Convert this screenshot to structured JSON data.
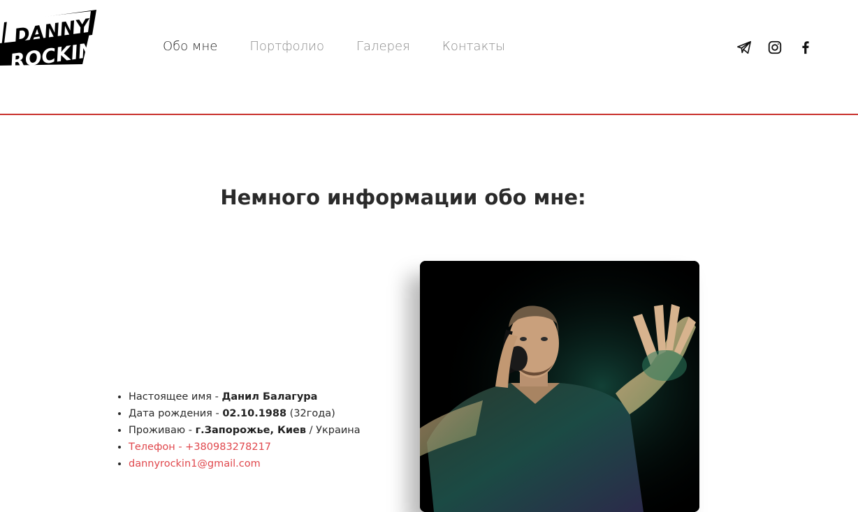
{
  "logo": {
    "line1": "DANNY",
    "line2": "ROCKIN"
  },
  "nav": [
    {
      "label": "Обо мне",
      "active": true
    },
    {
      "label": "Портфолио",
      "active": false
    },
    {
      "label": "Галерея",
      "active": false
    },
    {
      "label": "Контакты",
      "active": false
    }
  ],
  "social": [
    "telegram-icon",
    "instagram-icon",
    "facebook-icon"
  ],
  "section_title": "Немного информации обо мне:",
  "info": {
    "name_label": "Настоящее имя - ",
    "name_value": "Данил Балагура",
    "birth_label": "Дата рождения - ",
    "birth_value": "02.10.1988",
    "birth_extra": " (32года)",
    "city_label": "Проживаю - ",
    "city_value": "г.Запорожье, Киев",
    "city_extra": " / Украина",
    "phone": "Телефон - +380983278217",
    "email": "dannyrockin1@gmail.com"
  },
  "colors": {
    "accent": "#c9302c",
    "link": "#e0474c"
  }
}
